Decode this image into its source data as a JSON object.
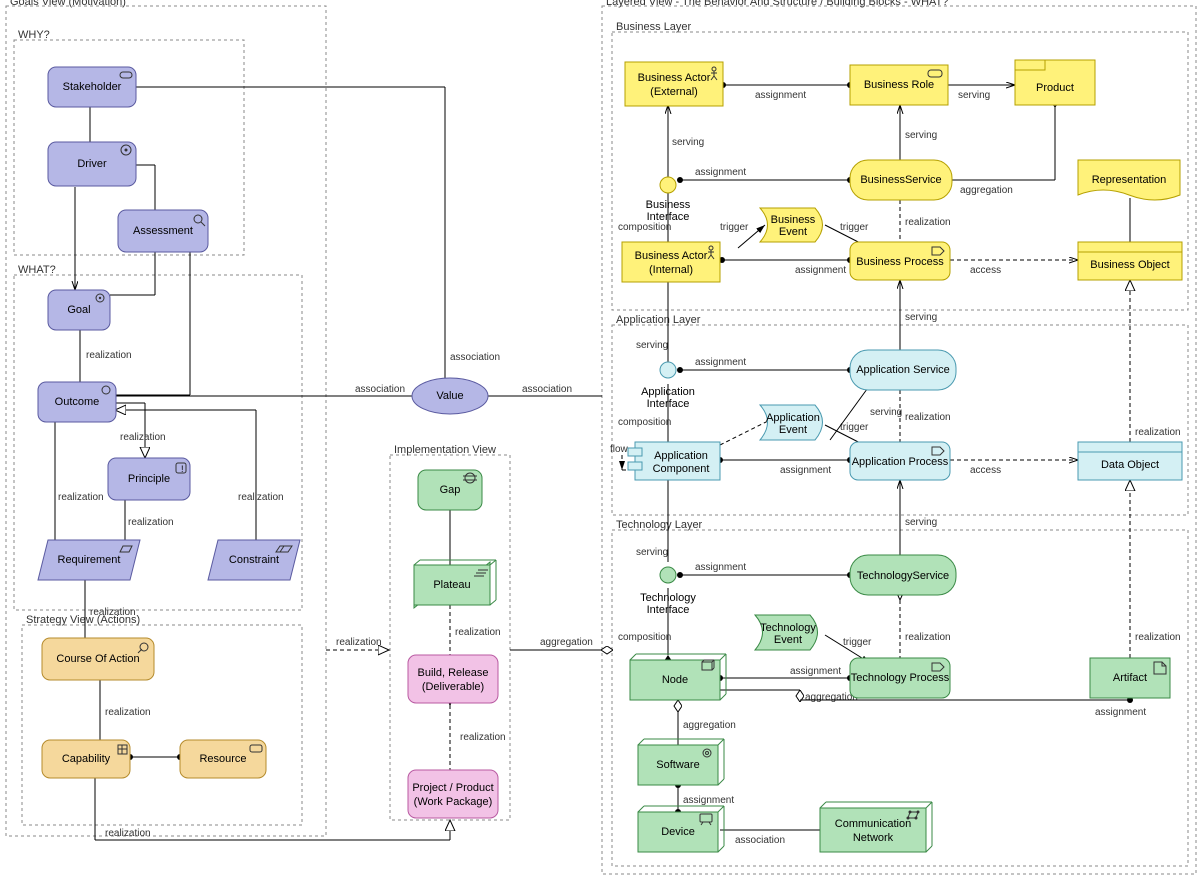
{
  "colors": {
    "motivation": "#b5b7e6",
    "strategy": "#f5d89c",
    "implementation_green": "#b1e2b8",
    "implementation_pink": "#f2c2e6",
    "business": "#fff27a",
    "application": "#d4f0f4",
    "technology": "#b1e2b8"
  },
  "groups": {
    "goals": "Goals View (Motivation)",
    "why": "WHY?",
    "what1": "WHAT?",
    "strategy": "Strategy View (Actions)",
    "impl": "Implementation View",
    "layered": "Layered View - The Behavior And Structure / Building Blocks - WHAT?",
    "business": "Business Layer",
    "application": "Application Layer",
    "technology": "Technology Layer"
  },
  "nodes": {
    "stakeholder": "Stakeholder",
    "driver": "Driver",
    "assessment": "Assessment",
    "goal": "Goal",
    "outcome": "Outcome",
    "principle": "Principle",
    "requirement": "Requirement",
    "constraint": "Constraint",
    "courseOfAction": "Course Of Action",
    "capability": "Capability",
    "resource": "Resource",
    "value": "Value",
    "gap": "Gap",
    "plateau": "Plateau",
    "buildRelease1": "Build, Release",
    "buildRelease2": "(Deliverable)",
    "projectProduct1": "Project / Product",
    "projectProduct2": "(Work Package)",
    "businessActorExt1": "Business Actor",
    "businessActorExt2": "(External)",
    "businessRole": "Business Role",
    "product": "Product",
    "businessInterface": "Business",
    "businessInterface2": "Interface",
    "businessService": "BusinessService",
    "representation": "Representation",
    "businessEvent1": "Business",
    "businessEvent2": "Event",
    "businessActorInt1": "Business Actor",
    "businessActorInt2": "(Internal)",
    "businessProcess": "Business Process",
    "businessObject": "Business Object",
    "applicationInterface1": "Application",
    "applicationInterface2": "Interface",
    "applicationService": "Application Service",
    "applicationEvent1": "Application",
    "applicationEvent2": "Event",
    "applicationComponent1": "Application",
    "applicationComponent2": "Component",
    "applicationProcess": "Application Process",
    "dataObject": "Data Object",
    "technologyInterface1": "Technology",
    "technologyInterface2": "Interface",
    "technologyService": "TechnologyService",
    "technologyEvent1": "Technology",
    "technologyEvent2": "Event",
    "node": "Node",
    "technologyProcess": "Technology Process",
    "artifact": "Artifact",
    "software": "Software",
    "device": "Device",
    "communicationNetwork1": "Communication",
    "communicationNetwork2": "Network"
  },
  "edgeLabels": {
    "realization": "realization",
    "association": "association",
    "assignment": "assignment",
    "serving": "serving",
    "composition": "composition",
    "trigger": "trigger",
    "access": "access",
    "aggregation": "aggregation",
    "flow": "flow"
  }
}
